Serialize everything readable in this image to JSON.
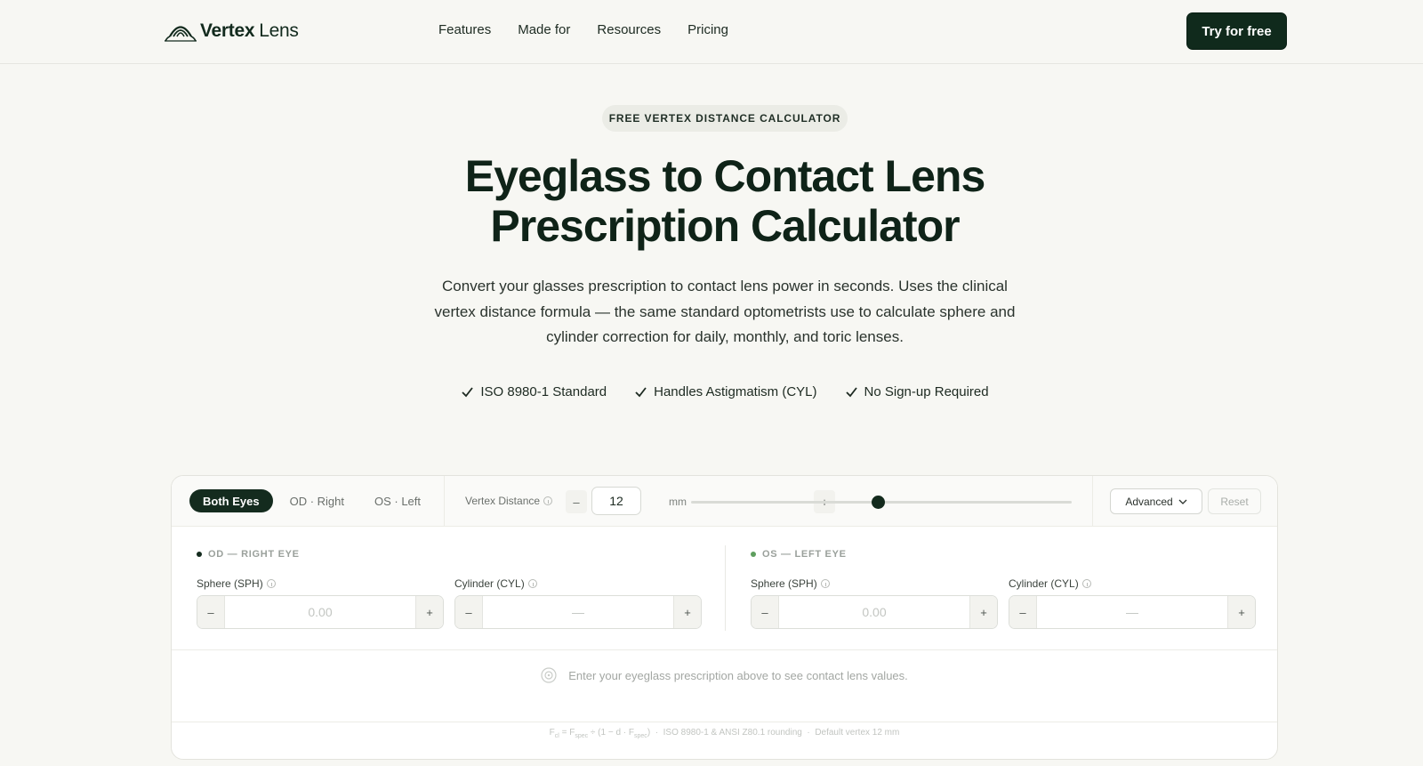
{
  "nav": {
    "brand_bold": "Vertex",
    "brand_light": "Lens",
    "brand_icon": "lens-logo-icon",
    "links": [
      "Features",
      "Made for",
      "Resources",
      "Pricing"
    ],
    "cta": "Try for free"
  },
  "hero": {
    "badge": "FREE VERTEX DISTANCE CALCULATOR",
    "title_line1": "Eyeglass to Contact Lens",
    "title_line2": "Prescription Calculator",
    "subtitle": "Convert your glasses prescription to contact lens power in seconds. Uses the clinical vertex distance formula — the same standard optometrists use to calculate sphere and cylinder correction for daily, monthly, and toric lenses.",
    "checks": [
      "ISO 8980-1 Standard",
      "Handles Astigmatism (CYL)",
      "No Sign-up Required"
    ]
  },
  "calculator": {
    "tabs": [
      "Both Eyes",
      "OD · Right",
      "OS · Left"
    ],
    "active_tab": "Both Eyes",
    "vertex_label": "Vertex Distance",
    "vertex_minus": "–",
    "vertex_value": "12",
    "vertex_plus": "+",
    "vertex_unit": "mm",
    "slider_fraction": 0.49,
    "advanced_label": "Advanced",
    "reset_label": "Reset",
    "right_eye": {
      "heading": "OD — RIGHT EYE",
      "dot_color": "#142b1e",
      "sphere_label": "Sphere (SPH)",
      "sphere_value": "0.00",
      "cyl_label": "Cylinder (CYL)",
      "cyl_value": "—"
    },
    "left_eye": {
      "heading": "OS — LEFT EYE",
      "dot_color": "#5e9e5e",
      "sphere_label": "Sphere (SPH)",
      "sphere_value": "0.00",
      "cyl_label": "Cylinder (CYL)",
      "cyl_value": "—"
    },
    "stepper_minus": "–",
    "stepper_plus": "+",
    "empty_message": "Enter your eyeglass prescription above to see contact lens values.",
    "formula_note": "ISO 8980-1 & ANSI Z80.1 rounding",
    "formula_default": "Default vertex 12 mm",
    "separator": "·"
  },
  "colors": {
    "accent": "#102a1c",
    "background": "#f7f7f3"
  }
}
